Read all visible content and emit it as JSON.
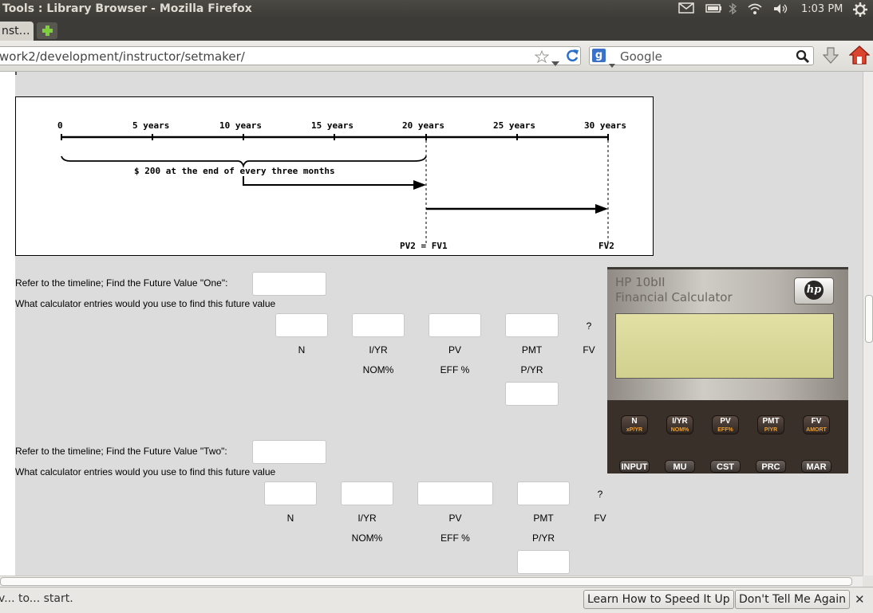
{
  "window": {
    "title": "Tools : Library Browser - Mozilla Firefox",
    "clock": "1:03 PM"
  },
  "tabs": [
    {
      "label": "nst…"
    }
  ],
  "navbar": {
    "url": "work2/development/instructor/setmaker/",
    "search_placeholder": "Google"
  },
  "timeline": {
    "ticks": [
      "0",
      "5 years",
      "10 years",
      "15 years",
      "20 years",
      "25 years",
      "30 years"
    ],
    "payment_label": "$ 200 at the end of every three months",
    "marker_mid": "PV2 = FV1",
    "marker_end": "FV2"
  },
  "questions": [
    {
      "prompt": "Refer to the timeline; Find the Future Value \"One\":",
      "entries_prompt": "What calculator entries would you use to find this future value",
      "unknown_marker": "?",
      "columns": [
        "N",
        "I/YR",
        "PV",
        "PMT",
        "FV"
      ],
      "secondary": [
        "NOM%",
        "EFF %",
        "P/YR"
      ]
    },
    {
      "prompt": "Refer to the timeline; Find the Future Value \"Two\":",
      "entries_prompt": "What calculator entries would you use to find this future value",
      "unknown_marker": "?",
      "columns": [
        "N",
        "I/YR",
        "PV",
        "PMT",
        "FV"
      ],
      "secondary": [
        "NOM%",
        "EFF %",
        "P/YR"
      ]
    }
  ],
  "calculator": {
    "brand": "HP 10bII",
    "subtitle": "Financial Calculator",
    "logo": "hp",
    "keys_top": [
      {
        "main": "N",
        "sub": "xP/YR"
      },
      {
        "main": "I/YR",
        "sub": "NOM%"
      },
      {
        "main": "PV",
        "sub": "EFF%"
      },
      {
        "main": "PMT",
        "sub": "P/YR"
      },
      {
        "main": "FV",
        "sub": "AMORT"
      }
    ],
    "keys_bottom": [
      "INPUT",
      "MU",
      "CST",
      "PRC",
      "MAR"
    ]
  },
  "statusbar": {
    "text": "v... to... start.",
    "learn_button": "Learn How to Speed It Up",
    "dont_tell_button": "Don't Tell Me Again"
  }
}
